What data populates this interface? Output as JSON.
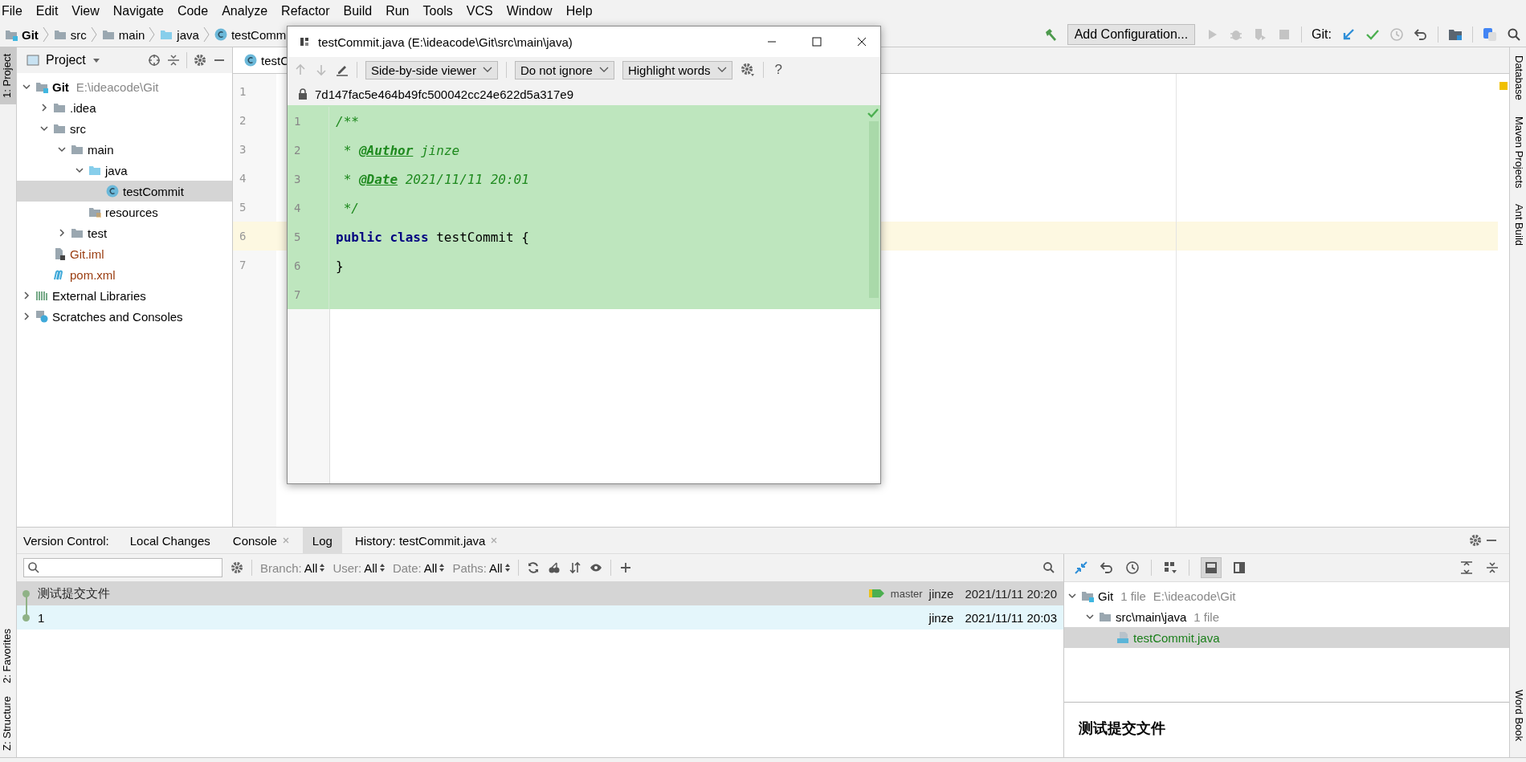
{
  "menu": [
    "File",
    "Edit",
    "View",
    "Navigate",
    "Code",
    "Analyze",
    "Refactor",
    "Build",
    "Run",
    "Tools",
    "VCS",
    "Window",
    "Help"
  ],
  "breadcrumbs": [
    {
      "label": "Git",
      "kind": "module"
    },
    {
      "label": "src",
      "kind": "folder"
    },
    {
      "label": "main",
      "kind": "folder"
    },
    {
      "label": "java",
      "kind": "source"
    },
    {
      "label": "testComm",
      "kind": "class"
    }
  ],
  "run_toolbar": {
    "configuration": "Add Configuration...",
    "vcs_label": "Git:"
  },
  "left_strip": [
    {
      "label": "1: Project",
      "selected": true
    },
    {
      "label": "2: Favorites",
      "selected": false
    },
    {
      "label": "Z: Structure",
      "selected": false
    }
  ],
  "right_strip": [
    "Database",
    "Maven Projects",
    "Ant Build",
    "Word Book"
  ],
  "project_panel": {
    "title": "Project",
    "tree": [
      {
        "label": "Git",
        "kind": "module",
        "path": "E:\\ideacode\\Git",
        "expanded": true,
        "selected": false,
        "children": [
          {
            "label": ".idea",
            "kind": "folder",
            "expanded": false,
            "selected": false
          },
          {
            "label": "src",
            "kind": "folder",
            "expanded": true,
            "selected": false,
            "children": [
              {
                "label": "main",
                "kind": "folder",
                "expanded": true,
                "selected": false,
                "children": [
                  {
                    "label": "java",
                    "kind": "source",
                    "expanded": true,
                    "selected": false,
                    "children": [
                      {
                        "label": "testCommit",
                        "kind": "class",
                        "selected": true
                      }
                    ]
                  },
                  {
                    "label": "resources",
                    "kind": "resources",
                    "selected": false
                  }
                ]
              },
              {
                "label": "test",
                "kind": "folder",
                "expanded": false,
                "selected": false
              }
            ]
          },
          {
            "label": "Git.iml",
            "kind": "iml",
            "selected": false,
            "color": "#9a3d10"
          },
          {
            "label": "pom.xml",
            "kind": "maven",
            "selected": false,
            "color": "#9a3d10"
          }
        ]
      },
      {
        "label": "External Libraries",
        "kind": "libraries",
        "expanded": false,
        "selected": false
      },
      {
        "label": "Scratches and Consoles",
        "kind": "scratches",
        "expanded": false,
        "selected": false
      }
    ]
  },
  "editor": {
    "tab": "testC",
    "lines": [
      {
        "number": "1",
        "selected": false
      },
      {
        "number": "2",
        "selected": false
      },
      {
        "number": "3",
        "selected": false
      },
      {
        "number": "4",
        "selected": false
      },
      {
        "number": "5",
        "selected": false
      },
      {
        "number": "6",
        "selected": true
      },
      {
        "number": "7",
        "selected": false
      }
    ]
  },
  "diff_window": {
    "title": "testCommit.java (E:\\ideacode\\Git\\src\\main\\java)",
    "viewer": "Side-by-side viewer",
    "ignore": "Do not ignore",
    "highlight": "Highlight words",
    "help": "?",
    "revision": "7d147fac5e464b49fc500042cc24e622d5a317e9",
    "lines": [
      {
        "number": "1",
        "tokens": [
          {
            "text": "/**",
            "kind": "comment"
          }
        ]
      },
      {
        "number": "2",
        "tokens": [
          {
            "text": " * ",
            "kind": "comment"
          },
          {
            "text": "@Author",
            "kind": "tag"
          },
          {
            "text": " jinze",
            "kind": "comment"
          }
        ]
      },
      {
        "number": "3",
        "tokens": [
          {
            "text": " * ",
            "kind": "comment"
          },
          {
            "text": "@Date",
            "kind": "tag"
          },
          {
            "text": " 2021/11/11 20:01",
            "kind": "comment"
          }
        ]
      },
      {
        "number": "4",
        "tokens": [
          {
            "text": " */",
            "kind": "comment"
          }
        ]
      },
      {
        "number": "5",
        "tokens": [
          {
            "text": "public",
            "kind": "keyword"
          },
          {
            "text": " class",
            "kind": "keyword"
          },
          {
            "text": " testCommit {",
            "kind": "plain"
          }
        ]
      },
      {
        "number": "6",
        "tokens": [
          {
            "text": "}",
            "kind": "plain"
          }
        ]
      },
      {
        "number": "7"
      }
    ]
  },
  "vcs_panel": {
    "title": "Version Control:",
    "tabs": [
      {
        "label": "Local Changes",
        "selected": false,
        "closable": false
      },
      {
        "label": "Console",
        "selected": false,
        "closable": true
      },
      {
        "label": "Log",
        "selected": true,
        "closable": false
      },
      {
        "label": "History: testCommit.java",
        "selected": false,
        "closable": true
      }
    ],
    "filters": [
      {
        "label": "Branch:",
        "value": "All"
      },
      {
        "label": "User:",
        "value": "All"
      },
      {
        "label": "Date:",
        "value": "All"
      },
      {
        "label": "Paths:",
        "value": "All"
      }
    ],
    "commits": [
      {
        "message": "测试提交文件",
        "branch": "master",
        "author": "jinze",
        "date": "2021/11/11 20:20",
        "selected": true,
        "highlighted": false
      },
      {
        "message": "1",
        "author": "jinze",
        "date": "2021/11/11 20:03",
        "selected": false,
        "highlighted": true
      }
    ],
    "changes": [
      {
        "label": "Git",
        "kind": "module",
        "count": "1 file",
        "path": "E:\\ideacode\\Git",
        "selected": false,
        "expanded": true,
        "children": [
          {
            "label": "src\\main\\java",
            "kind": "folder",
            "count": "1 file",
            "selected": false,
            "expanded": true,
            "children": [
              {
                "label": "testCommit.java",
                "kind": "java",
                "selected": true,
                "color": "#1a7f1a"
              }
            ]
          }
        ]
      }
    ],
    "details": "测试提交文件"
  }
}
